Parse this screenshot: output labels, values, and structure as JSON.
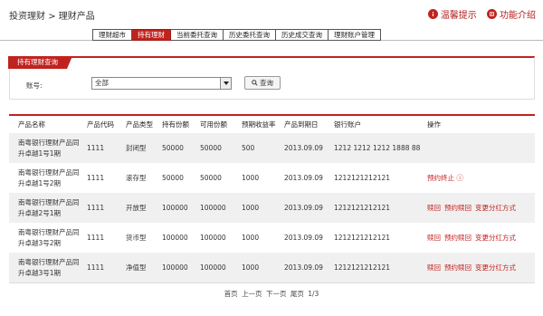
{
  "breadcrumb": [
    "投资理财",
    ">",
    "理财产品"
  ],
  "top_links": {
    "warm_tip": "温馨提示",
    "feature_intro": "功能介绍"
  },
  "tabs": [
    {
      "label": "理财超市",
      "active": false
    },
    {
      "label": "持有理财",
      "active": true
    },
    {
      "label": "当前委托查询",
      "active": false
    },
    {
      "label": "历史委托查询",
      "active": false
    },
    {
      "label": "历史成交查询",
      "active": false
    },
    {
      "label": "理财账户管理",
      "active": false
    }
  ],
  "query": {
    "title": "持有理财查询",
    "account_label": "账号:",
    "account_selected": "全部",
    "search_label": "查询"
  },
  "table": {
    "headers": [
      "产品名称",
      "产品代码",
      "产品类型",
      "持有份额",
      "可用份额",
      "预期收益率",
      "产品到期日",
      "银行账户",
      "操作"
    ],
    "rows": [
      {
        "name1": "南粤银行理财产品同",
        "name2": "升卓越1号1期",
        "code": "1111",
        "type": "封闭型",
        "hold": "50000",
        "avail": "50000",
        "rate": "500",
        "due": "2013.09.09",
        "account": "1212 1212 1212 1888 88",
        "ops": []
      },
      {
        "name1": "南粤银行理财产品同",
        "name2": "升卓越1号2期",
        "code": "1111",
        "type": "滚存型",
        "hold": "50000",
        "avail": "50000",
        "rate": "1000",
        "due": "2013.09.09",
        "account": "1212121212121",
        "ops": [
          "预约终止 ⓘ"
        ]
      },
      {
        "name1": "南粤银行理财产品同",
        "name2": "升卓越2号1期",
        "code": "1111",
        "type": "开放型",
        "hold": "100000",
        "avail": "100000",
        "rate": "1000",
        "due": "2013.09.09",
        "account": "1212121212121",
        "ops": [
          "赎回",
          "预约赎回",
          "变更分红方式"
        ]
      },
      {
        "name1": "南粤银行理财产品同",
        "name2": "升卓越3号2期",
        "code": "1111",
        "type": "货币型",
        "hold": "100000",
        "avail": "100000",
        "rate": "1000",
        "due": "2013.09.09",
        "account": "1212121212121",
        "ops": [
          "赎回",
          "预约赎回",
          "变更分红方式"
        ]
      },
      {
        "name1": "南粤银行理财产品同",
        "name2": "升卓越3号1期",
        "code": "1111",
        "type": "净值型",
        "hold": "100000",
        "avail": "100000",
        "rate": "1000",
        "due": "2013.09.09",
        "account": "1212121212121",
        "ops": [
          "赎回",
          "预约赎回",
          "变更分红方式"
        ]
      }
    ]
  },
  "pager": {
    "first": "首页",
    "prev": "上一页",
    "next": "下一页",
    "last": "尾页",
    "page": "1/3"
  },
  "colors": {
    "accent": "#c0231f",
    "stripe": "#f0f0f0"
  },
  "icons": {
    "warm_tip": "info-icon",
    "feature_intro": "book-icon",
    "search": "magnifier-icon",
    "dropdown": "triangle-down-icon"
  }
}
